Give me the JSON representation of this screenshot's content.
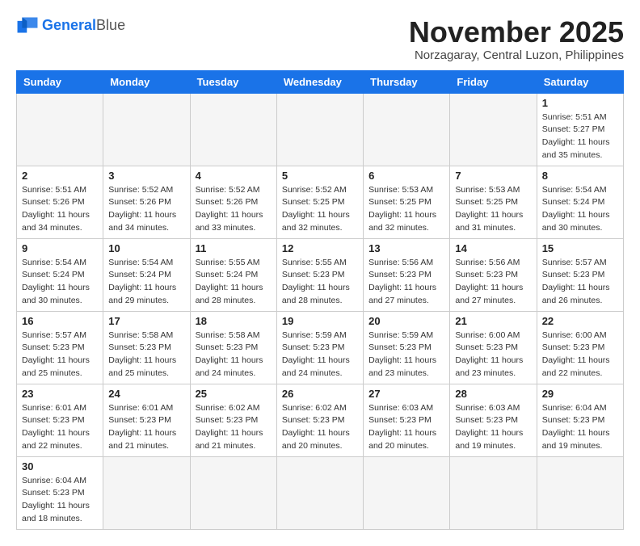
{
  "logo": {
    "general": "General",
    "blue": "Blue"
  },
  "header": {
    "month": "November 2025",
    "location": "Norzagaray, Central Luzon, Philippines"
  },
  "weekdays": [
    "Sunday",
    "Monday",
    "Tuesday",
    "Wednesday",
    "Thursday",
    "Friday",
    "Saturday"
  ],
  "weeks": [
    [
      {
        "day": "",
        "info": ""
      },
      {
        "day": "",
        "info": ""
      },
      {
        "day": "",
        "info": ""
      },
      {
        "day": "",
        "info": ""
      },
      {
        "day": "",
        "info": ""
      },
      {
        "day": "",
        "info": ""
      },
      {
        "day": "1",
        "info": "Sunrise: 5:51 AM\nSunset: 5:27 PM\nDaylight: 11 hours\nand 35 minutes."
      }
    ],
    [
      {
        "day": "2",
        "info": "Sunrise: 5:51 AM\nSunset: 5:26 PM\nDaylight: 11 hours\nand 34 minutes."
      },
      {
        "day": "3",
        "info": "Sunrise: 5:52 AM\nSunset: 5:26 PM\nDaylight: 11 hours\nand 34 minutes."
      },
      {
        "day": "4",
        "info": "Sunrise: 5:52 AM\nSunset: 5:26 PM\nDaylight: 11 hours\nand 33 minutes."
      },
      {
        "day": "5",
        "info": "Sunrise: 5:52 AM\nSunset: 5:25 PM\nDaylight: 11 hours\nand 32 minutes."
      },
      {
        "day": "6",
        "info": "Sunrise: 5:53 AM\nSunset: 5:25 PM\nDaylight: 11 hours\nand 32 minutes."
      },
      {
        "day": "7",
        "info": "Sunrise: 5:53 AM\nSunset: 5:25 PM\nDaylight: 11 hours\nand 31 minutes."
      },
      {
        "day": "8",
        "info": "Sunrise: 5:54 AM\nSunset: 5:24 PM\nDaylight: 11 hours\nand 30 minutes."
      }
    ],
    [
      {
        "day": "9",
        "info": "Sunrise: 5:54 AM\nSunset: 5:24 PM\nDaylight: 11 hours\nand 30 minutes."
      },
      {
        "day": "10",
        "info": "Sunrise: 5:54 AM\nSunset: 5:24 PM\nDaylight: 11 hours\nand 29 minutes."
      },
      {
        "day": "11",
        "info": "Sunrise: 5:55 AM\nSunset: 5:24 PM\nDaylight: 11 hours\nand 28 minutes."
      },
      {
        "day": "12",
        "info": "Sunrise: 5:55 AM\nSunset: 5:23 PM\nDaylight: 11 hours\nand 28 minutes."
      },
      {
        "day": "13",
        "info": "Sunrise: 5:56 AM\nSunset: 5:23 PM\nDaylight: 11 hours\nand 27 minutes."
      },
      {
        "day": "14",
        "info": "Sunrise: 5:56 AM\nSunset: 5:23 PM\nDaylight: 11 hours\nand 27 minutes."
      },
      {
        "day": "15",
        "info": "Sunrise: 5:57 AM\nSunset: 5:23 PM\nDaylight: 11 hours\nand 26 minutes."
      }
    ],
    [
      {
        "day": "16",
        "info": "Sunrise: 5:57 AM\nSunset: 5:23 PM\nDaylight: 11 hours\nand 25 minutes."
      },
      {
        "day": "17",
        "info": "Sunrise: 5:58 AM\nSunset: 5:23 PM\nDaylight: 11 hours\nand 25 minutes."
      },
      {
        "day": "18",
        "info": "Sunrise: 5:58 AM\nSunset: 5:23 PM\nDaylight: 11 hours\nand 24 minutes."
      },
      {
        "day": "19",
        "info": "Sunrise: 5:59 AM\nSunset: 5:23 PM\nDaylight: 11 hours\nand 24 minutes."
      },
      {
        "day": "20",
        "info": "Sunrise: 5:59 AM\nSunset: 5:23 PM\nDaylight: 11 hours\nand 23 minutes."
      },
      {
        "day": "21",
        "info": "Sunrise: 6:00 AM\nSunset: 5:23 PM\nDaylight: 11 hours\nand 23 minutes."
      },
      {
        "day": "22",
        "info": "Sunrise: 6:00 AM\nSunset: 5:23 PM\nDaylight: 11 hours\nand 22 minutes."
      }
    ],
    [
      {
        "day": "23",
        "info": "Sunrise: 6:01 AM\nSunset: 5:23 PM\nDaylight: 11 hours\nand 22 minutes."
      },
      {
        "day": "24",
        "info": "Sunrise: 6:01 AM\nSunset: 5:23 PM\nDaylight: 11 hours\nand 21 minutes."
      },
      {
        "day": "25",
        "info": "Sunrise: 6:02 AM\nSunset: 5:23 PM\nDaylight: 11 hours\nand 21 minutes."
      },
      {
        "day": "26",
        "info": "Sunrise: 6:02 AM\nSunset: 5:23 PM\nDaylight: 11 hours\nand 20 minutes."
      },
      {
        "day": "27",
        "info": "Sunrise: 6:03 AM\nSunset: 5:23 PM\nDaylight: 11 hours\nand 20 minutes."
      },
      {
        "day": "28",
        "info": "Sunrise: 6:03 AM\nSunset: 5:23 PM\nDaylight: 11 hours\nand 19 minutes."
      },
      {
        "day": "29",
        "info": "Sunrise: 6:04 AM\nSunset: 5:23 PM\nDaylight: 11 hours\nand 19 minutes."
      }
    ],
    [
      {
        "day": "30",
        "info": "Sunrise: 6:04 AM\nSunset: 5:23 PM\nDaylight: 11 hours\nand 18 minutes."
      },
      {
        "day": "",
        "info": ""
      },
      {
        "day": "",
        "info": ""
      },
      {
        "day": "",
        "info": ""
      },
      {
        "day": "",
        "info": ""
      },
      {
        "day": "",
        "info": ""
      },
      {
        "day": "",
        "info": ""
      }
    ]
  ]
}
